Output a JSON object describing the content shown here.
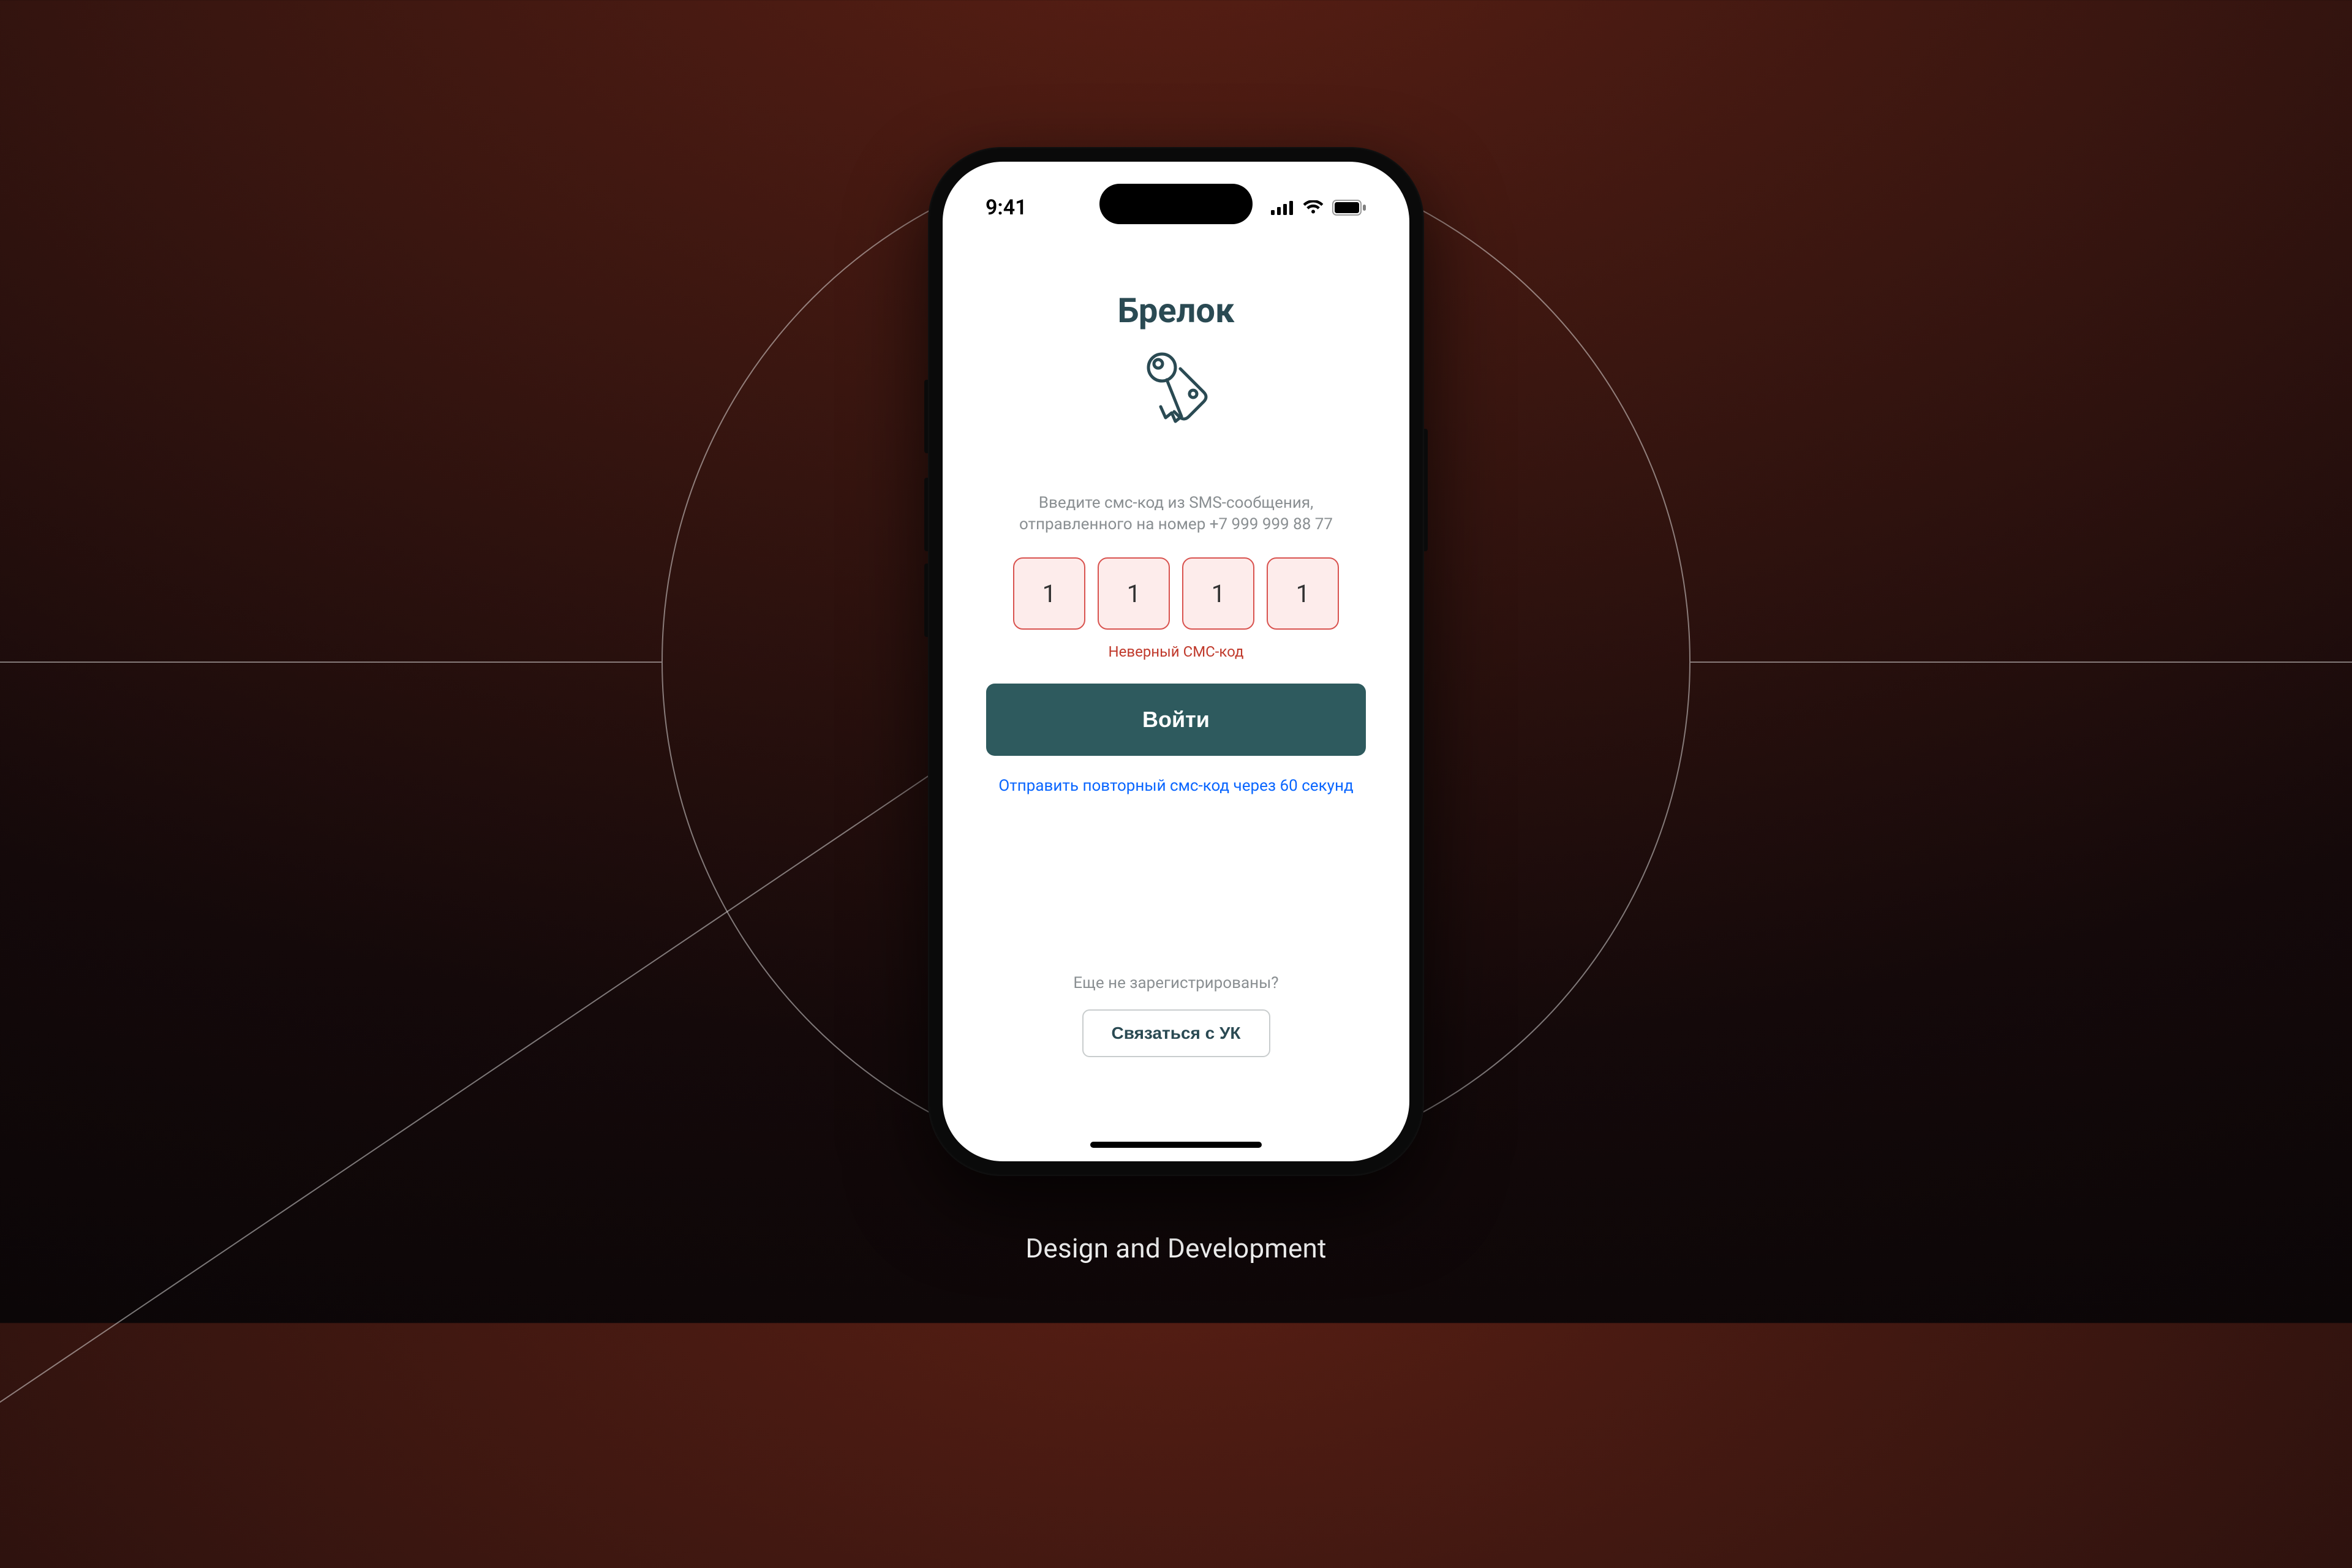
{
  "caption": "Design and Development",
  "status": {
    "time": "9:41"
  },
  "app": {
    "title": "Брелок",
    "instruction_line1": "Введите смс-код из SMS-сообщения,",
    "instruction_line2": "отправленного на номер +7 999 999 88 77",
    "otp": [
      "1",
      "1",
      "1",
      "1"
    ],
    "error": "Неверный СМС-код",
    "login_label": "Войти",
    "resend": "Отправить повторный смс-код через 60 секунд",
    "register_prompt": "Еще не зарегистрированы?",
    "contact_label": "Связаться с УК"
  }
}
